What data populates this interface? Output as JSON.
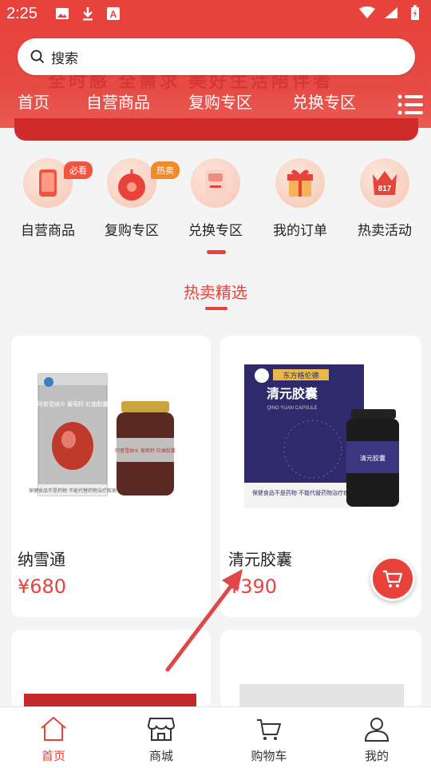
{
  "status_bar": {
    "time": "2:25",
    "left_icons": [
      "image-icon",
      "download-icon",
      "a-icon"
    ],
    "right_icons": [
      "wifi-icon",
      "signal-icon",
      "battery-icon"
    ]
  },
  "colors": {
    "accent": "#e8423c",
    "text": "#222222",
    "tab_inactive": "#333333"
  },
  "search": {
    "placeholder": "搜索"
  },
  "hero": {
    "banner_text": "全时感 全需求 美好生活陪伴者"
  },
  "top_nav": {
    "items": [
      "首页",
      "自营商品",
      "复购专区",
      "兑换专区"
    ]
  },
  "categories": [
    {
      "label": "自营商品",
      "badge": "必看",
      "icon": "phone-icon"
    },
    {
      "label": "复购专区",
      "badge": "热卖",
      "icon": "disc-icon"
    },
    {
      "label": "兑换专区",
      "badge": "",
      "icon": "machine-icon"
    },
    {
      "label": "我的订单",
      "badge": "",
      "icon": "gift-icon"
    },
    {
      "label": "热卖活动",
      "badge": "",
      "icon": "crown-817-icon"
    }
  ],
  "crown_text": "817",
  "section": {
    "title": "热卖精选"
  },
  "products": [
    {
      "name": "纳雪通",
      "price": "¥680",
      "box_text": "阿普雪纳® 葡萄籽 红曲胶囊",
      "bottle_text": "阿普雪纳® 葡萄籽 红曲胶囊",
      "warning": "保健食品不是药物 不能代替药物治疗疾病"
    },
    {
      "name": "清元胶囊",
      "price": "¥390",
      "box_brand": "东方格伦德",
      "box_title": "清元胶囊",
      "box_sub": "QING YUAN CAPSULE",
      "bottle_text": "清元胶囊",
      "warning": "保健食品不是药物 不能代替药物治疗疾病"
    }
  ],
  "tabbar": {
    "items": [
      {
        "label": "首页",
        "icon": "home-icon",
        "active": true
      },
      {
        "label": "商城",
        "icon": "store-icon",
        "active": false
      },
      {
        "label": "购物车",
        "icon": "cart-icon",
        "active": false
      },
      {
        "label": "我的",
        "icon": "user-icon",
        "active": false
      }
    ]
  }
}
